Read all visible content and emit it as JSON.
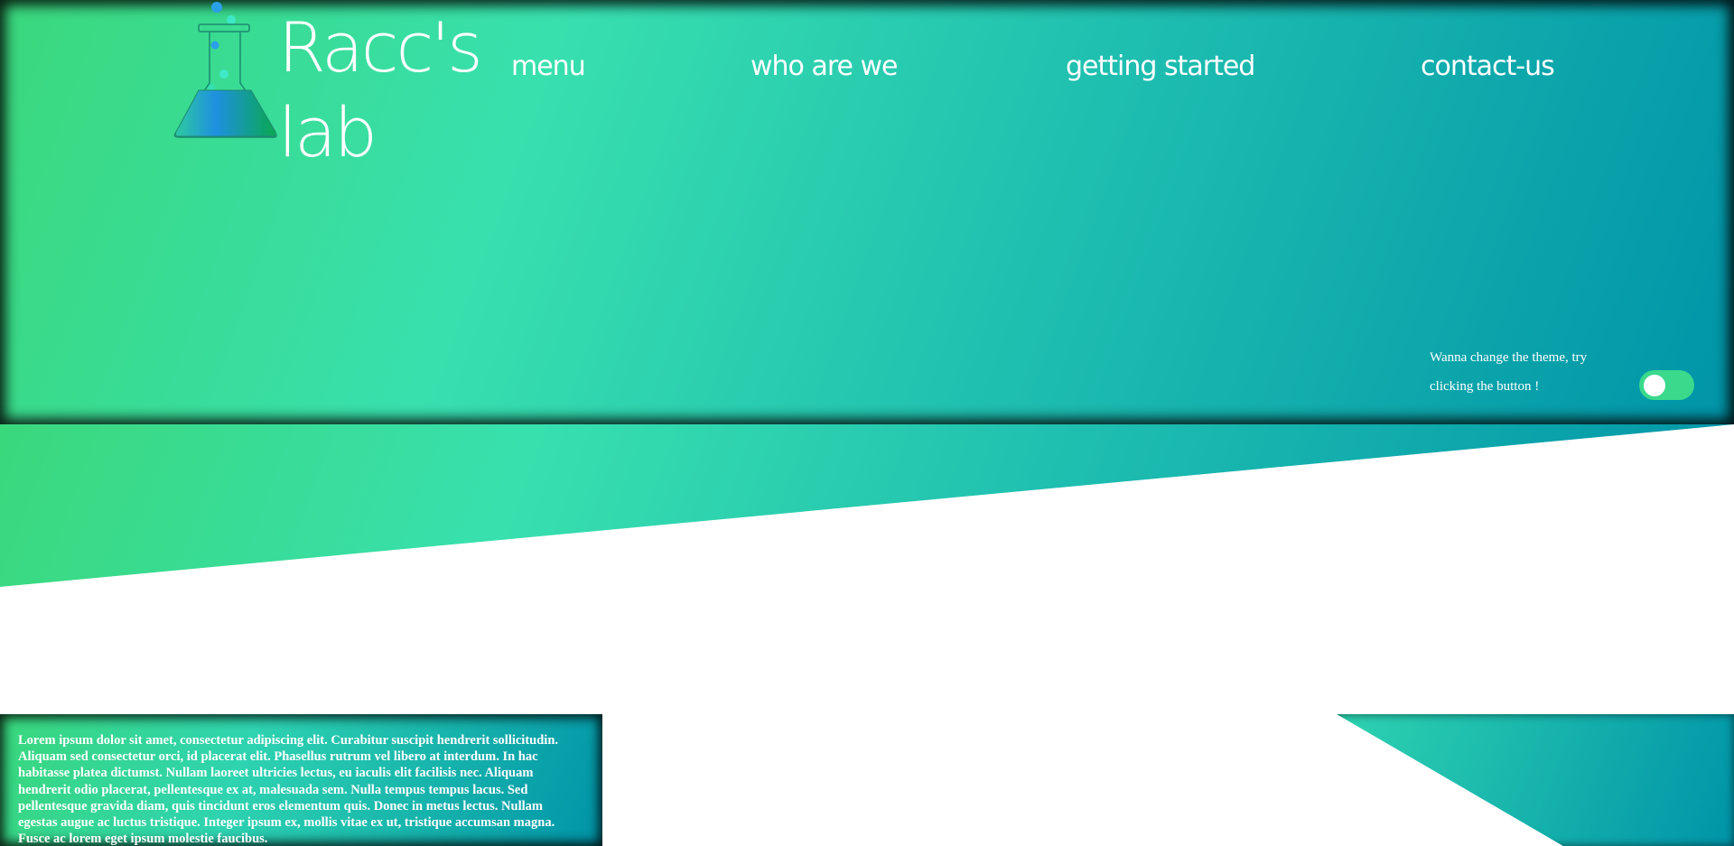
{
  "brand": {
    "line1": "Racc's",
    "line2": "lab",
    "icon": "flask-icon"
  },
  "nav": {
    "menu": "menu",
    "who": "who are we",
    "getting_started": "getting started",
    "contact": "contact-us"
  },
  "theme": {
    "hint": "Wanna change the theme, try clicking the button !",
    "toggle_on": false
  },
  "content": {
    "lorem": "Lorem ipsum dolor sit amet, consectetur adipiscing elit. Curabitur suscipit hendrerit sollicitudin. Aliquam sed consectetur orci, id placerat elit. Phasellus rutrum vel libero at interdum. In hac habitasse platea dictumst. Nullam laoreet ultricies lectus, eu iaculis elit facilisis nec. Aliquam hendrerit odio placerat, pellentesque ex at, malesuada sem. Nulla tempus tempus lacus. Sed pellentesque gravida diam, quis tincidunt eros elementum quis. Donec in metus lectus. Nullam egestas augue ac luctus tristique. Integer ipsum ex, mollis vitae ex ut, tristique accumsan magna. Fusce ac lorem eget ipsum molestie faucibus."
  },
  "colors": {
    "gradient_start": "#3ad87c",
    "gradient_mid": "#38e0ae",
    "gradient_end": "#0094a8",
    "toggle": "#3bd98c",
    "text": "#ffffff"
  }
}
